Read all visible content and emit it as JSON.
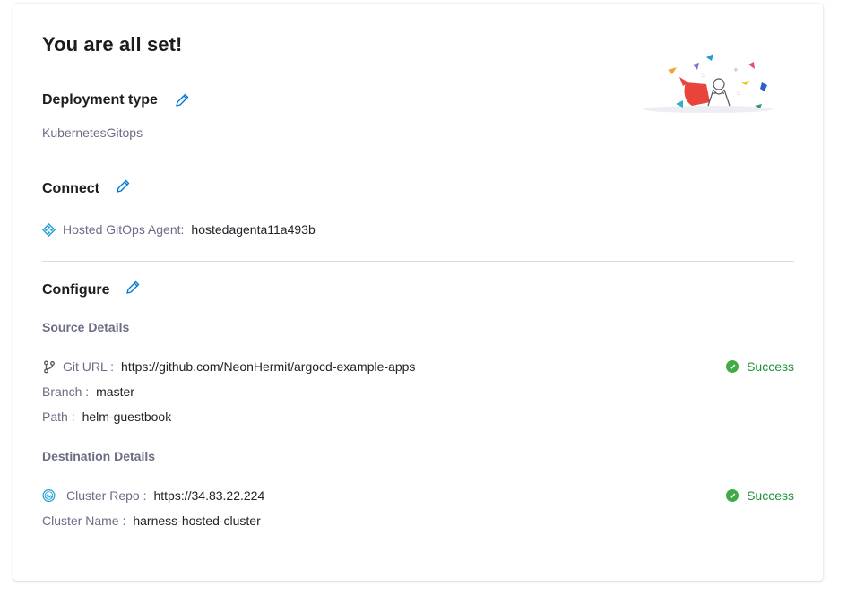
{
  "title": "You are all set!",
  "deployment": {
    "heading": "Deployment type",
    "value": "KubernetesGitops"
  },
  "connect": {
    "heading": "Connect",
    "agent_label": "Hosted GitOps Agent:",
    "agent_value": "hostedagenta11a493b"
  },
  "configure": {
    "heading": "Configure",
    "source": {
      "subheading": "Source Details",
      "git_url_label": "Git URL :",
      "git_url_value": "https://github.com/NeonHermit/argocd-example-apps",
      "branch_label": "Branch :",
      "branch_value": "master",
      "path_label": "Path :",
      "path_value": "helm-guestbook",
      "status": "Success"
    },
    "destination": {
      "subheading": "Destination Details",
      "cluster_repo_label": "Cluster Repo :",
      "cluster_repo_value": "https://34.83.22.224",
      "cluster_name_label": "Cluster Name :",
      "cluster_name_value": "harness-hosted-cluster",
      "status": "Success"
    }
  },
  "icons": {
    "edit": "pencil-icon",
    "agent": "gitops-agent-icon",
    "git": "git-branch-icon",
    "cluster": "kubernetes-cluster-icon",
    "success": "check-circle-icon",
    "illustration": "celebration-illustration"
  },
  "colors": {
    "accent": "#0278d5",
    "success": "#42ab45",
    "success_text": "#1e8f3b",
    "muted": "#6b6d85"
  }
}
